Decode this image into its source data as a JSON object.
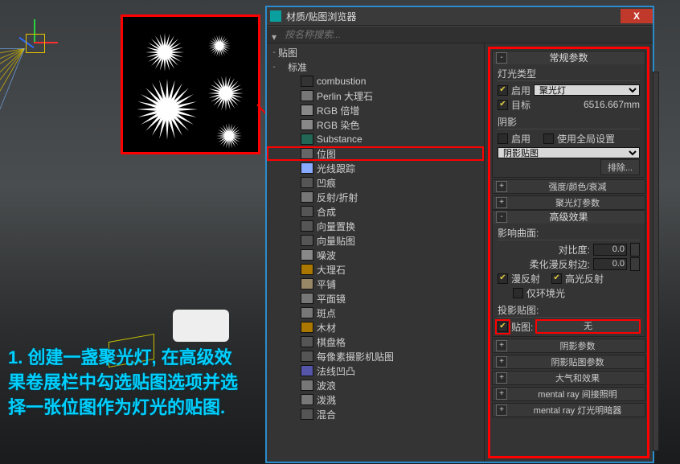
{
  "titlebar": {
    "title": "材质/贴图浏览器"
  },
  "search": {
    "placeholder": "按名称搜索..."
  },
  "tree": {
    "root": "贴图",
    "group": "标准",
    "items": [
      "combustion",
      "Perlin 大理石",
      "RGB 倍增",
      "RGB 染色",
      "Substance",
      "位图",
      "光线跟踪",
      "凹痕",
      "反射/折射",
      "合成",
      "向量置换",
      "向量贴图",
      "噪波",
      "大理石",
      "平铺",
      "平面镜",
      "斑点",
      "木材",
      "棋盘格",
      "每像素摄影机贴图",
      "法线凹凸",
      "波浪",
      "泼溅",
      "混合"
    ],
    "selected_index": 5,
    "cat_index": 7
  },
  "side": {
    "general": {
      "title": "常规参数",
      "light_type_label": "灯光类型",
      "enable_label": "启用",
      "type_value": "聚光灯",
      "target_label": "目标",
      "target_value": "6516.667mm",
      "shadow_label": "阴影",
      "shadow_enable_label": "启用",
      "global_label": "使用全局设置",
      "shadow_map_value": "阴影贴图",
      "exclude_label": "排除..."
    },
    "rollups_collapsed": [
      "强度/颜色/衰减",
      "聚光灯参数"
    ],
    "advanced": {
      "title": "高级效果",
      "affect_label": "影响曲面:",
      "contrast_label": "对比度:",
      "contrast_value": "0.0",
      "soften_label": "柔化漫反射边:",
      "soften_value": "0.0",
      "diffuse_label": "漫反射",
      "specular_label": "高光反射",
      "ambient_label": "仅环境光",
      "proj_label": "投影贴图:",
      "map_label": "贴图:",
      "map_value": "无"
    },
    "bottom_rollups": [
      "阴影参数",
      "阴影贴图参数",
      "大气和效果",
      "mental ray 间接照明",
      "mental ray 灯光明暗器"
    ]
  },
  "instruction": "1. 创建一盏聚光灯, 在高级效果卷展栏中勾选贴图选项并选择一张位图作为灯光的贴图.",
  "close_glyph": "X",
  "colors": {
    "accent": "#ff0000",
    "frame": "#2a8ccc"
  }
}
